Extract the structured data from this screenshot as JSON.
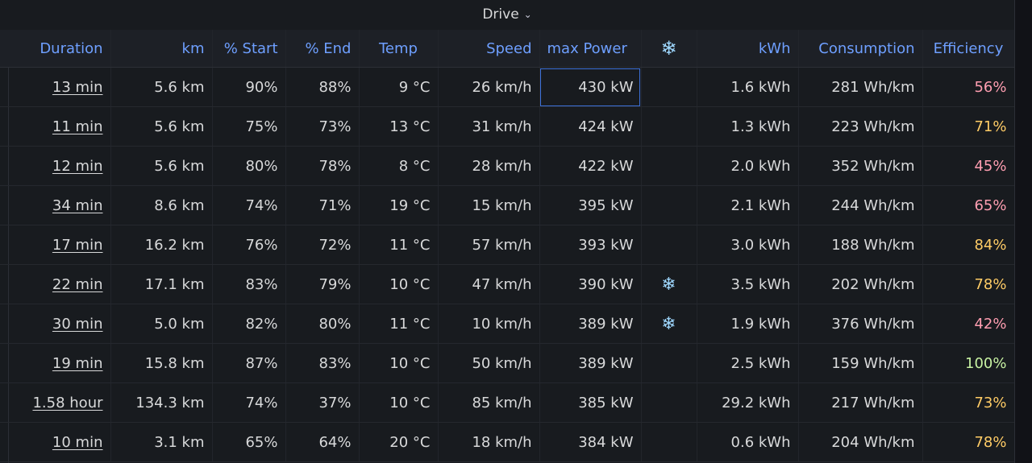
{
  "panel": {
    "title": "Drive",
    "chevron": "⌄"
  },
  "columns": [
    {
      "label": "Duration",
      "align": "right"
    },
    {
      "label": "km",
      "align": "right"
    },
    {
      "label": "% Start",
      "align": "right"
    },
    {
      "label": "% End",
      "align": "right"
    },
    {
      "label": "Temp",
      "align": "center"
    },
    {
      "label": "Speed",
      "align": "right"
    },
    {
      "label": "max Power",
      "align": "left"
    },
    {
      "label": "❄",
      "align": "center"
    },
    {
      "label": "kWh",
      "align": "right"
    },
    {
      "label": "Consumption",
      "align": "right"
    },
    {
      "label": "Efficiency",
      "align": "center"
    }
  ],
  "rows": [
    {
      "duration": "13 min",
      "km": "5.6 km",
      "start": "90%",
      "end": "88%",
      "temp": "9 °C",
      "speed": "26 km/h",
      "power": "430 kW",
      "snow": "",
      "kwh": "1.6 kWh",
      "consumption": "281 Wh/km",
      "efficiency": "56%",
      "eff_color": "#ff9eb1"
    },
    {
      "duration": "11 min",
      "km": "5.6 km",
      "start": "75%",
      "end": "73%",
      "temp": "13 °C",
      "speed": "31 km/h",
      "power": "424 kW",
      "snow": "",
      "kwh": "1.3 kWh",
      "consumption": "223 Wh/km",
      "efficiency": "71%",
      "eff_color": "#ffcc66"
    },
    {
      "duration": "12 min",
      "km": "5.6 km",
      "start": "80%",
      "end": "78%",
      "temp": "8 °C",
      "speed": "28 km/h",
      "power": "422 kW",
      "snow": "",
      "kwh": "2.0 kWh",
      "consumption": "352 Wh/km",
      "efficiency": "45%",
      "eff_color": "#ff9eb1"
    },
    {
      "duration": "34 min",
      "km": "8.6 km",
      "start": "74%",
      "end": "71%",
      "temp": "19 °C",
      "speed": "15 km/h",
      "power": "395 kW",
      "snow": "",
      "kwh": "2.1 kWh",
      "consumption": "244 Wh/km",
      "efficiency": "65%",
      "eff_color": "#ff9eb1"
    },
    {
      "duration": "17 min",
      "km": "16.2 km",
      "start": "76%",
      "end": "72%",
      "temp": "11 °C",
      "speed": "57 km/h",
      "power": "393 kW",
      "snow": "",
      "kwh": "3.0 kWh",
      "consumption": "188 Wh/km",
      "efficiency": "84%",
      "eff_color": "#ffcc66"
    },
    {
      "duration": "22 min",
      "km": "17.1 km",
      "start": "83%",
      "end": "79%",
      "temp": "10 °C",
      "speed": "47 km/h",
      "power": "390 kW",
      "snow": "❄",
      "kwh": "3.5 kWh",
      "consumption": "202 Wh/km",
      "efficiency": "78%",
      "eff_color": "#ffcc66"
    },
    {
      "duration": "30 min",
      "km": "5.0 km",
      "start": "82%",
      "end": "80%",
      "temp": "11 °C",
      "speed": "10 km/h",
      "power": "389 kW",
      "snow": "❄",
      "kwh": "1.9 kWh",
      "consumption": "376 Wh/km",
      "efficiency": "42%",
      "eff_color": "#ff9eb1"
    },
    {
      "duration": "19 min",
      "km": "15.8 km",
      "start": "87%",
      "end": "83%",
      "temp": "10 °C",
      "speed": "50 km/h",
      "power": "389 kW",
      "snow": "",
      "kwh": "2.5 kWh",
      "consumption": "159 Wh/km",
      "efficiency": "100%",
      "eff_color": "#c8f2a3"
    },
    {
      "duration": "1.58 hour",
      "km": "134.3 km",
      "start": "74%",
      "end": "37%",
      "temp": "10 °C",
      "speed": "85 km/h",
      "power": "385 kW",
      "snow": "",
      "kwh": "29.2 kWh",
      "consumption": "217 Wh/km",
      "efficiency": "73%",
      "eff_color": "#ffcc66"
    },
    {
      "duration": "10 min",
      "km": "3.1 km",
      "start": "65%",
      "end": "64%",
      "temp": "20 °C",
      "speed": "18 km/h",
      "power": "384 kW",
      "snow": "",
      "kwh": "0.6 kWh",
      "consumption": "204 Wh/km",
      "efficiency": "78%",
      "eff_color": "#ffcc66"
    }
  ]
}
